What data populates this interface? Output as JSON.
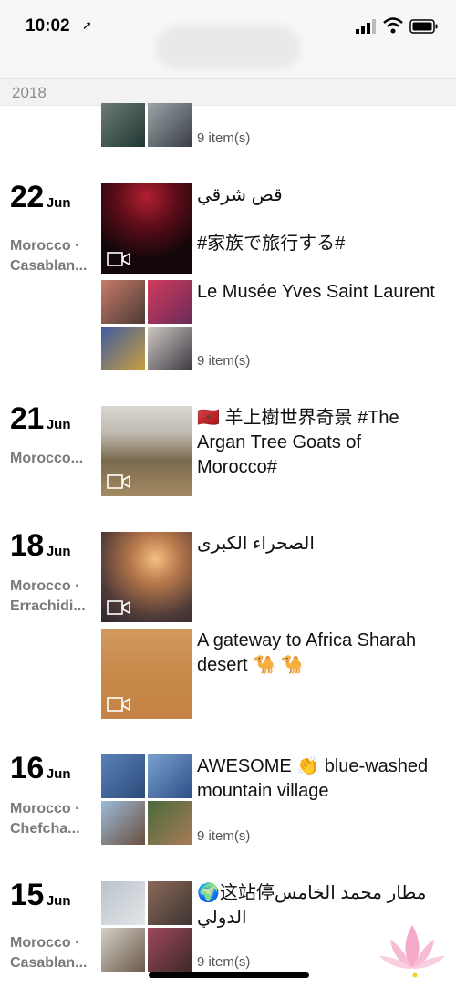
{
  "status": {
    "time": "10:02"
  },
  "year": "2018",
  "entries": [
    {
      "caption": "",
      "count": "9 item(s)"
    },
    {
      "day": "22",
      "month": "Jun",
      "place1": "Morocco ·",
      "place2": "Casablan...",
      "caption1": "قص شرقي",
      "caption2": "#家族で旅行する#",
      "caption3": "Le Musée Yves Saint Laurent",
      "count": "9 item(s)"
    },
    {
      "day": "21",
      "month": "Jun",
      "place1": "Morocco...",
      "caption": "🇲🇦 羊上樹世界奇景 #The Argan Tree Goats of Morocco#"
    },
    {
      "day": "18",
      "month": "Jun",
      "place1": "Morocco ·",
      "place2": "Errachidi...",
      "caption1": "الصحراء الكبرى",
      "caption2": "A gateway to Africa Sharah desert 🐪 🐪"
    },
    {
      "day": "16",
      "month": "Jun",
      "place1": "Morocco ·",
      "place2": "Chefcha...",
      "caption": "AWESOME 👏 blue-washed mountain village",
      "count": "9 item(s)"
    },
    {
      "day": "15",
      "month": "Jun",
      "place1": "Morocco ·",
      "place2": "Casablan...",
      "caption": "🌍这站停مطار محمد الخامس الدولي",
      "count": "9 item(s)"
    }
  ],
  "colors": {
    "header_bg": "#f7f7f7",
    "year_bg": "#f2f2f2",
    "place_text": "#7a7a7a"
  }
}
